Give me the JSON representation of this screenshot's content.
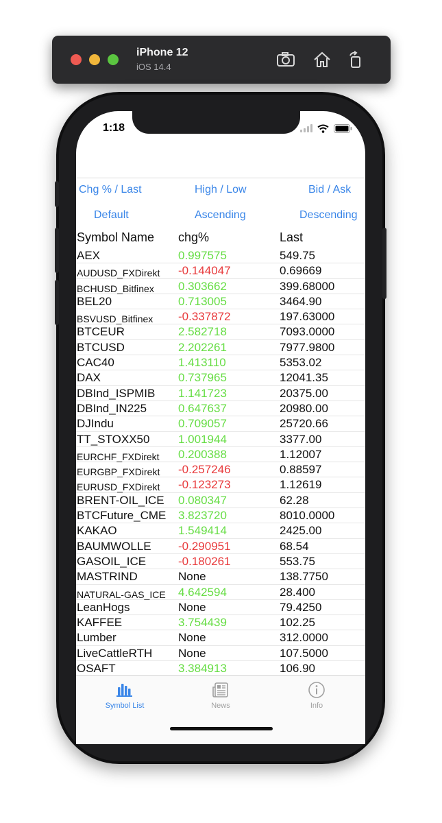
{
  "simulator": {
    "device": "iPhone 12",
    "os": "iOS 14.4"
  },
  "status_bar": {
    "time": "1:18"
  },
  "sort_fields": {
    "chg_last": "Chg % / Last",
    "high_low": "High / Low",
    "bid_ask": "Bid / Ask"
  },
  "sort_order": {
    "default": "Default",
    "ascending": "Ascending",
    "descending": "Descending"
  },
  "columns": {
    "symbol": "Symbol Name",
    "chg": "chg%",
    "last": "Last"
  },
  "rows": [
    {
      "name": "AEX",
      "chg": "0.997575",
      "last": "549.75"
    },
    {
      "name": "AUDUSD_FXDirekt",
      "chg": "-0.144047",
      "last": "0.69669"
    },
    {
      "name": "BCHUSD_Bitfinex",
      "chg": "0.303662",
      "last": "399.68000"
    },
    {
      "name": "BEL20",
      "chg": "0.713005",
      "last": "3464.90"
    },
    {
      "name": "BSVUSD_Bitfinex",
      "chg": "-0.337872",
      "last": "197.63000"
    },
    {
      "name": "BTCEUR",
      "chg": "2.582718",
      "last": "7093.0000"
    },
    {
      "name": "BTCUSD",
      "chg": "2.202261",
      "last": "7977.9800"
    },
    {
      "name": "CAC40",
      "chg": "1.413110",
      "last": "5353.02"
    },
    {
      "name": "DAX",
      "chg": "0.737965",
      "last": "12041.35"
    },
    {
      "name": "DBInd_ISPMIB",
      "chg": "1.141723",
      "last": "20375.00"
    },
    {
      "name": "DBInd_IN225",
      "chg": "0.647637",
      "last": "20980.00"
    },
    {
      "name": "DJIndu",
      "chg": "0.709057",
      "last": "25720.66"
    },
    {
      "name": "TT_STOXX50",
      "chg": "1.001944",
      "last": "3377.00"
    },
    {
      "name": "EURCHF_FXDirekt",
      "chg": "0.200388",
      "last": "1.12007"
    },
    {
      "name": "EURGBP_FXDirekt",
      "chg": "-0.257246",
      "last": "0.88597"
    },
    {
      "name": "EURUSD_FXDirekt",
      "chg": "-0.123273",
      "last": "1.12619"
    },
    {
      "name": "BRENT-OIL_ICE",
      "chg": "0.080347",
      "last": "62.28"
    },
    {
      "name": "BTCFuture_CME",
      "chg": "3.823720",
      "last": "8010.0000"
    },
    {
      "name": "KAKAO",
      "chg": "1.549414",
      "last": "2425.00"
    },
    {
      "name": "BAUMWOLLE",
      "chg": "-0.290951",
      "last": "68.54"
    },
    {
      "name": "GASOIL_ICE",
      "chg": "-0.180261",
      "last": "553.75"
    },
    {
      "name": "MASTRIND",
      "chg": "None",
      "last": "138.7750"
    },
    {
      "name": "NATURAL-GAS_ICE",
      "chg": "4.642594",
      "last": "28.400"
    },
    {
      "name": "LeanHogs",
      "chg": "None",
      "last": "79.4250"
    },
    {
      "name": "KAFFEE",
      "chg": "3.754439",
      "last": "102.25"
    },
    {
      "name": "Lumber",
      "chg": "None",
      "last": "312.0000"
    },
    {
      "name": "LiveCattleRTH",
      "chg": "None",
      "last": "107.5000"
    },
    {
      "name": "OSAFT",
      "chg": "3.384913",
      "last": "106.90"
    }
  ],
  "tabs": [
    {
      "label": "Symbol List",
      "icon": "chart-bars-icon",
      "active": true
    },
    {
      "label": "News",
      "icon": "newspaper-icon",
      "active": false
    },
    {
      "label": "Info",
      "icon": "info-circle-icon",
      "active": false
    }
  ],
  "colors": {
    "accent": "#3a86e8",
    "positive": "#66dd44",
    "negative": "#e8393b",
    "inactive_tab": "#a0a0a0"
  }
}
